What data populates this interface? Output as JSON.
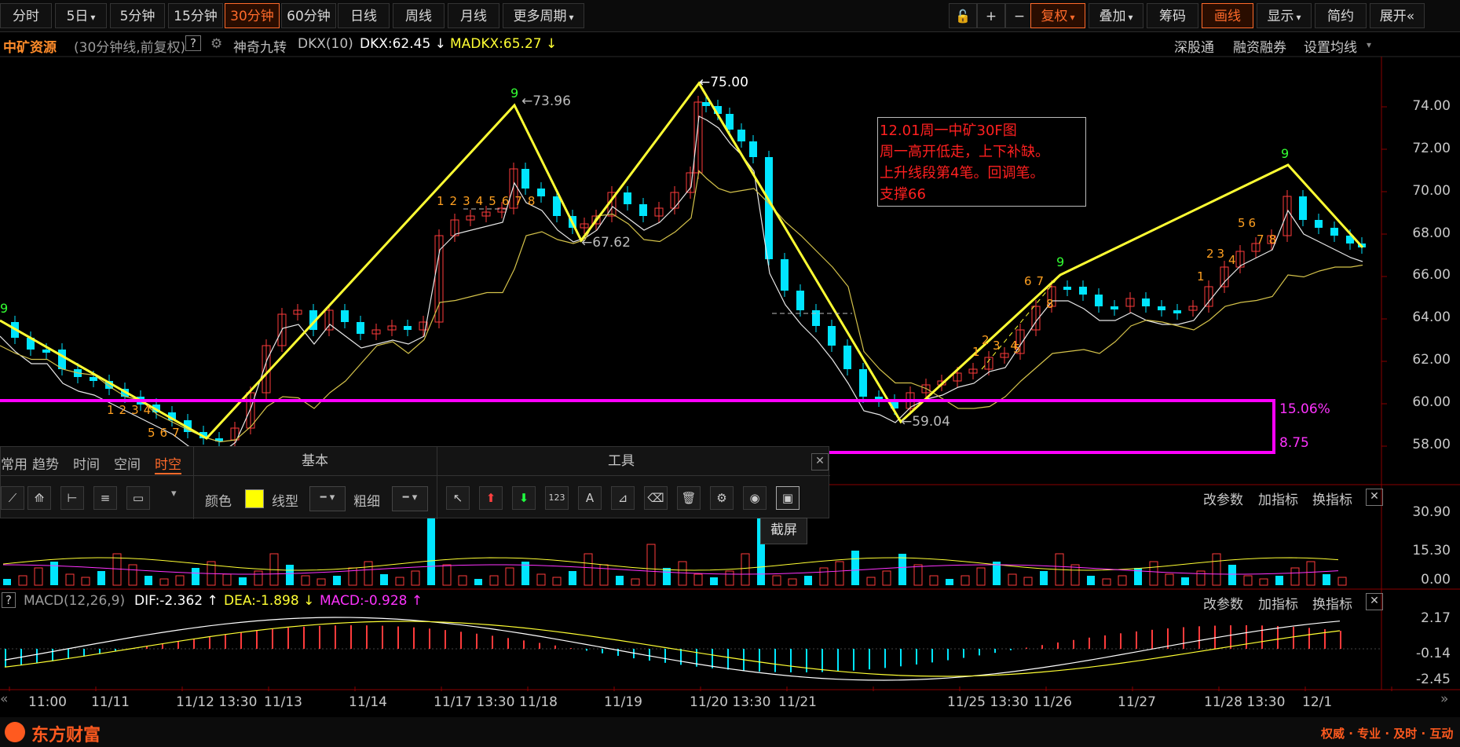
{
  "toolbar": {
    "periods": [
      "分时",
      "5日",
      "5分钟",
      "15分钟",
      "30分钟",
      "60分钟",
      "日线",
      "周线",
      "月线",
      "更多周期"
    ],
    "active_period": "30分钟",
    "right_buttons": [
      "复权",
      "叠加",
      "筹码",
      "画线",
      "显示",
      "简约",
      "展开"
    ],
    "plus": "+",
    "minus": "−"
  },
  "info": {
    "stock": "中矿资源",
    "mode": "(30分钟线,前复权)",
    "help": "?",
    "indicator": "神奇九转",
    "dkx_name": "DKX(10)",
    "dkx": "DKX:62.45 ↓",
    "madkx": "MADKX:65.27 ↓",
    "links": [
      "深股通",
      "融资融券",
      "设置均线"
    ]
  },
  "main_axis": [
    "74.00",
    "72.00",
    "70.00",
    "68.00",
    "66.00",
    "64.00",
    "62.00",
    "60.00",
    "58.00"
  ],
  "annotation": {
    "lines": [
      "12.01周一中矿30F图",
      "周一高开低走，上下补缺。",
      "上升线段第4笔。回调笔。",
      "支撑66"
    ]
  },
  "price_labels": {
    "p1": "←73.96",
    "p2": "←75.00",
    "p3": "←67.62",
    "p4": "←59.04",
    "box_pct": "15.06%",
    "box_val": "8.75"
  },
  "nine_marks": [
    "9",
    "9",
    "9",
    "9"
  ],
  "counts": {
    "seq1": [
      "1",
      "2",
      "3",
      "4",
      "5",
      "6",
      "7",
      "8"
    ],
    "seq2": [
      "1",
      "2",
      "3",
      "4",
      "5",
      "6",
      "7",
      "8"
    ],
    "seq3": [
      "1",
      "2",
      "3",
      "4",
      "5"
    ],
    "seq4": [
      "6",
      "7",
      "8"
    ],
    "seq5": [
      "1",
      "2",
      "3",
      "4",
      "5",
      "6",
      "7",
      "8"
    ],
    "top_left_nine": "9"
  },
  "vol_panel": {
    "buttons": [
      "改参数",
      "加指标",
      "换指标"
    ],
    "axis": [
      "30.90",
      "15.30",
      "0.00"
    ]
  },
  "macd_panel": {
    "help": "?",
    "name": "MACD(12,26,9)",
    "dif": "DIF:-2.362 ↑",
    "dea": "DEA:-1.898 ↓",
    "macd": "MACD:-0.928 ↑",
    "buttons": [
      "改参数",
      "加指标",
      "换指标"
    ],
    "axis": [
      "2.17",
      "-0.14",
      "-2.45"
    ]
  },
  "drawing_toolbox": {
    "tabs": [
      "常用",
      "趋势",
      "时间",
      "空间",
      "时空"
    ],
    "active_tab": "时空",
    "basic_title": "基本",
    "tools_title": "工具",
    "color_label": "颜色",
    "line_type_label": "线型",
    "thickness_label": "粗细",
    "tooltip": "截屏",
    "color_value": "#ffff00"
  },
  "dates": [
    "11:00",
    "11/11",
    "11/12 13:30",
    "11/13",
    "11/14",
    "11/17 13:30",
    "11/18",
    "11/19",
    "11/20 13:30",
    "11/21",
    "11/25 13:30",
    "11/26",
    "11/27",
    "11/28 13:30",
    "12/1"
  ],
  "footer": {
    "brand": "东方财富",
    "slogan": "权威 · 专业 · 及时 · 互动"
  },
  "colors": {
    "up": "#ff3b3b",
    "down": "#00e5ff",
    "trend": "#ffff33",
    "box": "#ff00ff",
    "accent": "#ff6a2a"
  }
}
